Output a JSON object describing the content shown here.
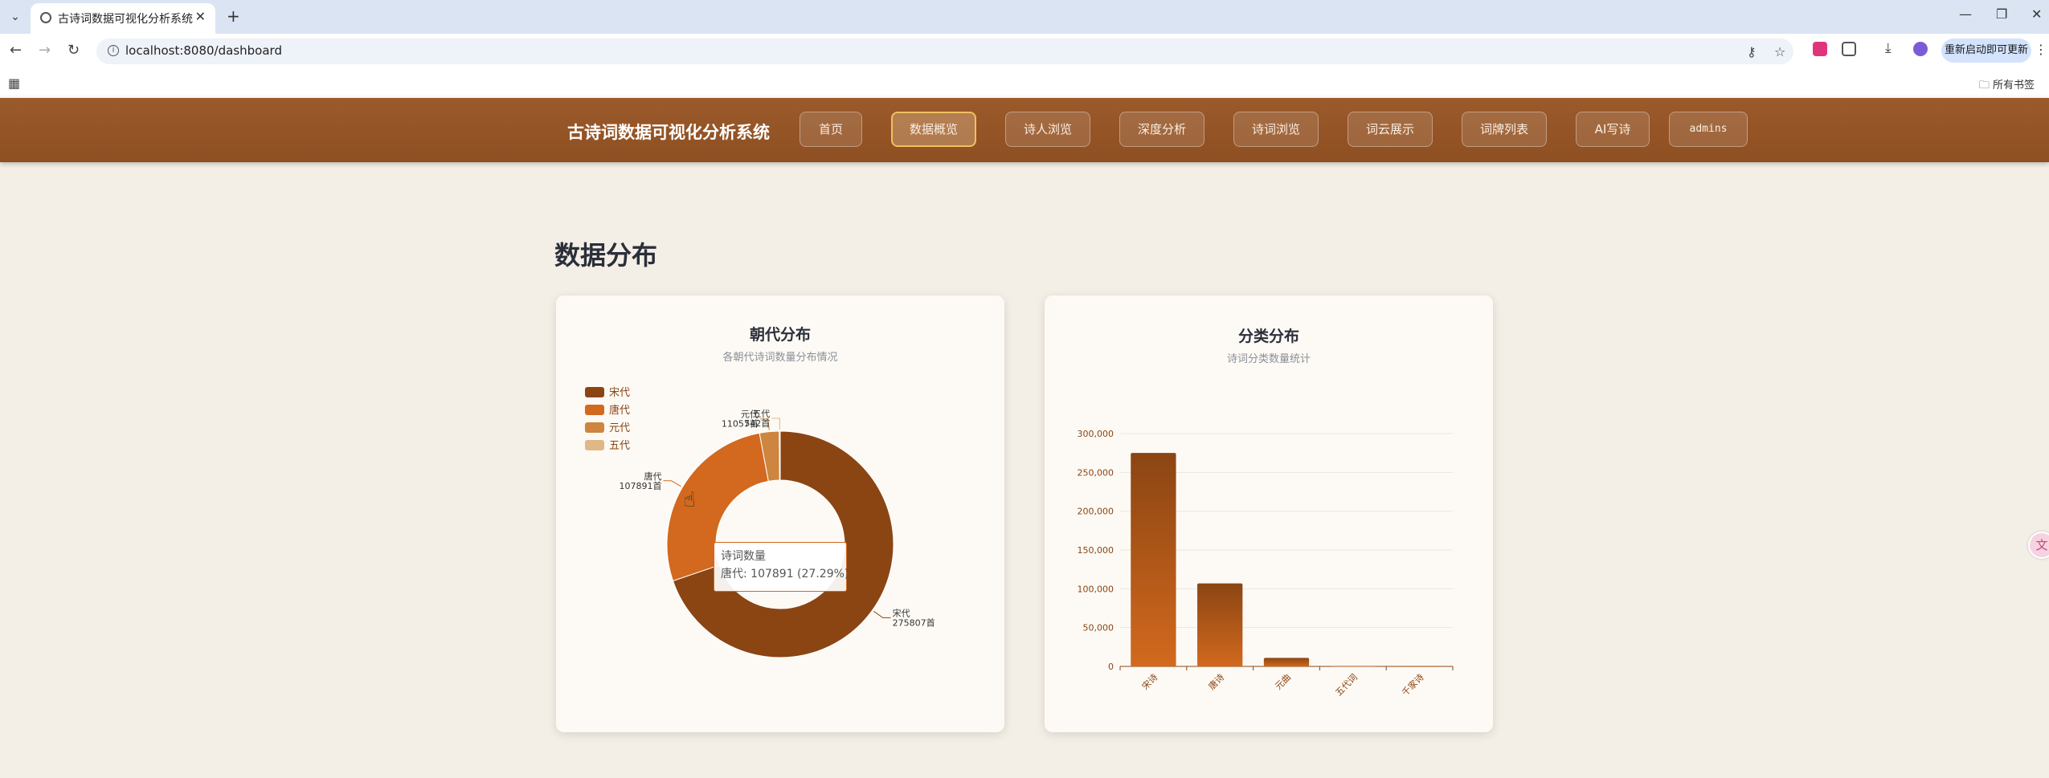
{
  "browser": {
    "tab_title": "古诗词数据可视化分析系统",
    "url": "localhost:8080/dashboard",
    "update_button": "重新启动即可更新",
    "bookmarks_folder": "所有书签"
  },
  "header": {
    "brand": "古诗词数据可视化分析系统",
    "nav": [
      {
        "label": "首页",
        "active": false
      },
      {
        "label": "数据概览",
        "active": true
      },
      {
        "label": "诗人浏览",
        "active": false
      },
      {
        "label": "深度分析",
        "active": false
      },
      {
        "label": "诗词浏览",
        "active": false
      },
      {
        "label": "词云展示",
        "active": false
      },
      {
        "label": "词牌列表",
        "active": false
      },
      {
        "label": "AI写诗",
        "active": false
      },
      {
        "label": "admins",
        "active": false
      }
    ]
  },
  "main": {
    "section_title": "数据分布",
    "dynasty_card": {
      "title": "朝代分布",
      "subtitle": "各朝代诗词数量分布情况",
      "tooltip": {
        "title": "诗词数量",
        "line": "唐代: 107891 (27.29%)"
      }
    },
    "category_card": {
      "title": "分类分布",
      "subtitle": "诗词分类数量统计"
    }
  },
  "chart_data": [
    {
      "type": "pie",
      "donut": true,
      "title": "朝代分布",
      "subtitle": "各朝代诗词数量分布情况",
      "legend_position": "top-left",
      "slices": [
        {
          "name": "宋代",
          "value": 275807,
          "label": "275807首",
          "color": "#8b4513"
        },
        {
          "name": "唐代",
          "value": 107891,
          "label": "107891首",
          "color": "#d2691e"
        },
        {
          "name": "元代",
          "value": 11057,
          "label": "11057首",
          "color": "#cd853f"
        },
        {
          "name": "五代",
          "value": 542,
          "label": "542首",
          "color": "#deb887"
        }
      ]
    },
    {
      "type": "bar",
      "title": "分类分布",
      "subtitle": "诗词分类数量统计",
      "categories": [
        "宋诗",
        "唐诗",
        "元曲",
        "五代词",
        "千家诗"
      ],
      "values": [
        275000,
        107000,
        11000,
        500,
        200
      ],
      "ylim": [
        0,
        300000
      ],
      "yticks": [
        "0",
        "50,000",
        "100,000",
        "150,000",
        "200,000",
        "250,000",
        "300,000"
      ],
      "grid": true,
      "colors": {
        "top": "#8b4513",
        "bottom": "#d2691e"
      }
    }
  ]
}
